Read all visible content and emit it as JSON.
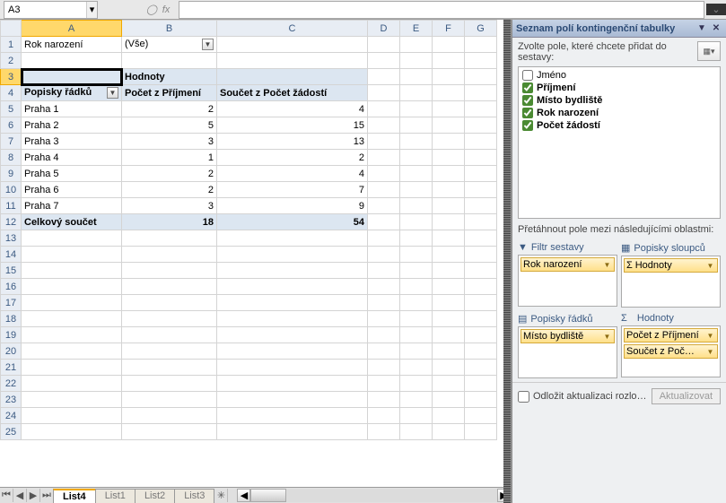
{
  "name_box": "A3",
  "fx_label": "fx",
  "columns": [
    "A",
    "B",
    "C",
    "D",
    "E",
    "F",
    "G"
  ],
  "rowcount": 25,
  "active_cell": {
    "row": 3,
    "col": "A"
  },
  "pivot": {
    "filter_label": "Rok narození",
    "filter_value": "(Vše)",
    "values_header": "Hodnoty",
    "row_header": "Popisky řádků",
    "col1": "Počet z Příjmení",
    "col2": "Součet z Počet žádostí",
    "rows": [
      {
        "label": "Praha 1",
        "v1": 2,
        "v2": 4
      },
      {
        "label": "Praha 2",
        "v1": 5,
        "v2": 15
      },
      {
        "label": "Praha 3",
        "v1": 3,
        "v2": 13
      },
      {
        "label": "Praha 4",
        "v1": 1,
        "v2": 2
      },
      {
        "label": "Praha 5",
        "v1": 2,
        "v2": 4
      },
      {
        "label": "Praha 6",
        "v1": 2,
        "v2": 7
      },
      {
        "label": "Praha 7",
        "v1": 3,
        "v2": 9
      }
    ],
    "total_label": "Celkový součet",
    "total_v1": 18,
    "total_v2": 54
  },
  "tabs": {
    "items": [
      "List4",
      "List1",
      "List2",
      "List3"
    ],
    "active": 0
  },
  "field_list": {
    "title": "Seznam polí kontingenční tabulky",
    "subtitle": "Zvolte pole, které chcete přidat do sestavy:",
    "fields": [
      {
        "name": "Jméno",
        "checked": false
      },
      {
        "name": "Příjmení",
        "checked": true
      },
      {
        "name": "Místo bydliště",
        "checked": true
      },
      {
        "name": "Rok narození",
        "checked": true
      },
      {
        "name": "Počet žádostí",
        "checked": true
      }
    ],
    "drag_label": "Přetáhnout pole mezi následujícími oblastmi:",
    "area_filter": "Filtr sestavy",
    "area_cols": "Popisky sloupců",
    "area_rows": "Popisky řádků",
    "area_vals": "Hodnoty",
    "sigma": "Σ",
    "filter_chip": "Rok narození",
    "cols_chip": "Hodnoty",
    "rows_chip": "Místo bydliště",
    "vals_chip1": "Počet z Příjmení",
    "vals_chip2": "Součet z Poč…",
    "defer": "Odložit aktualizaci rozlo…",
    "update": "Aktualizovat"
  }
}
